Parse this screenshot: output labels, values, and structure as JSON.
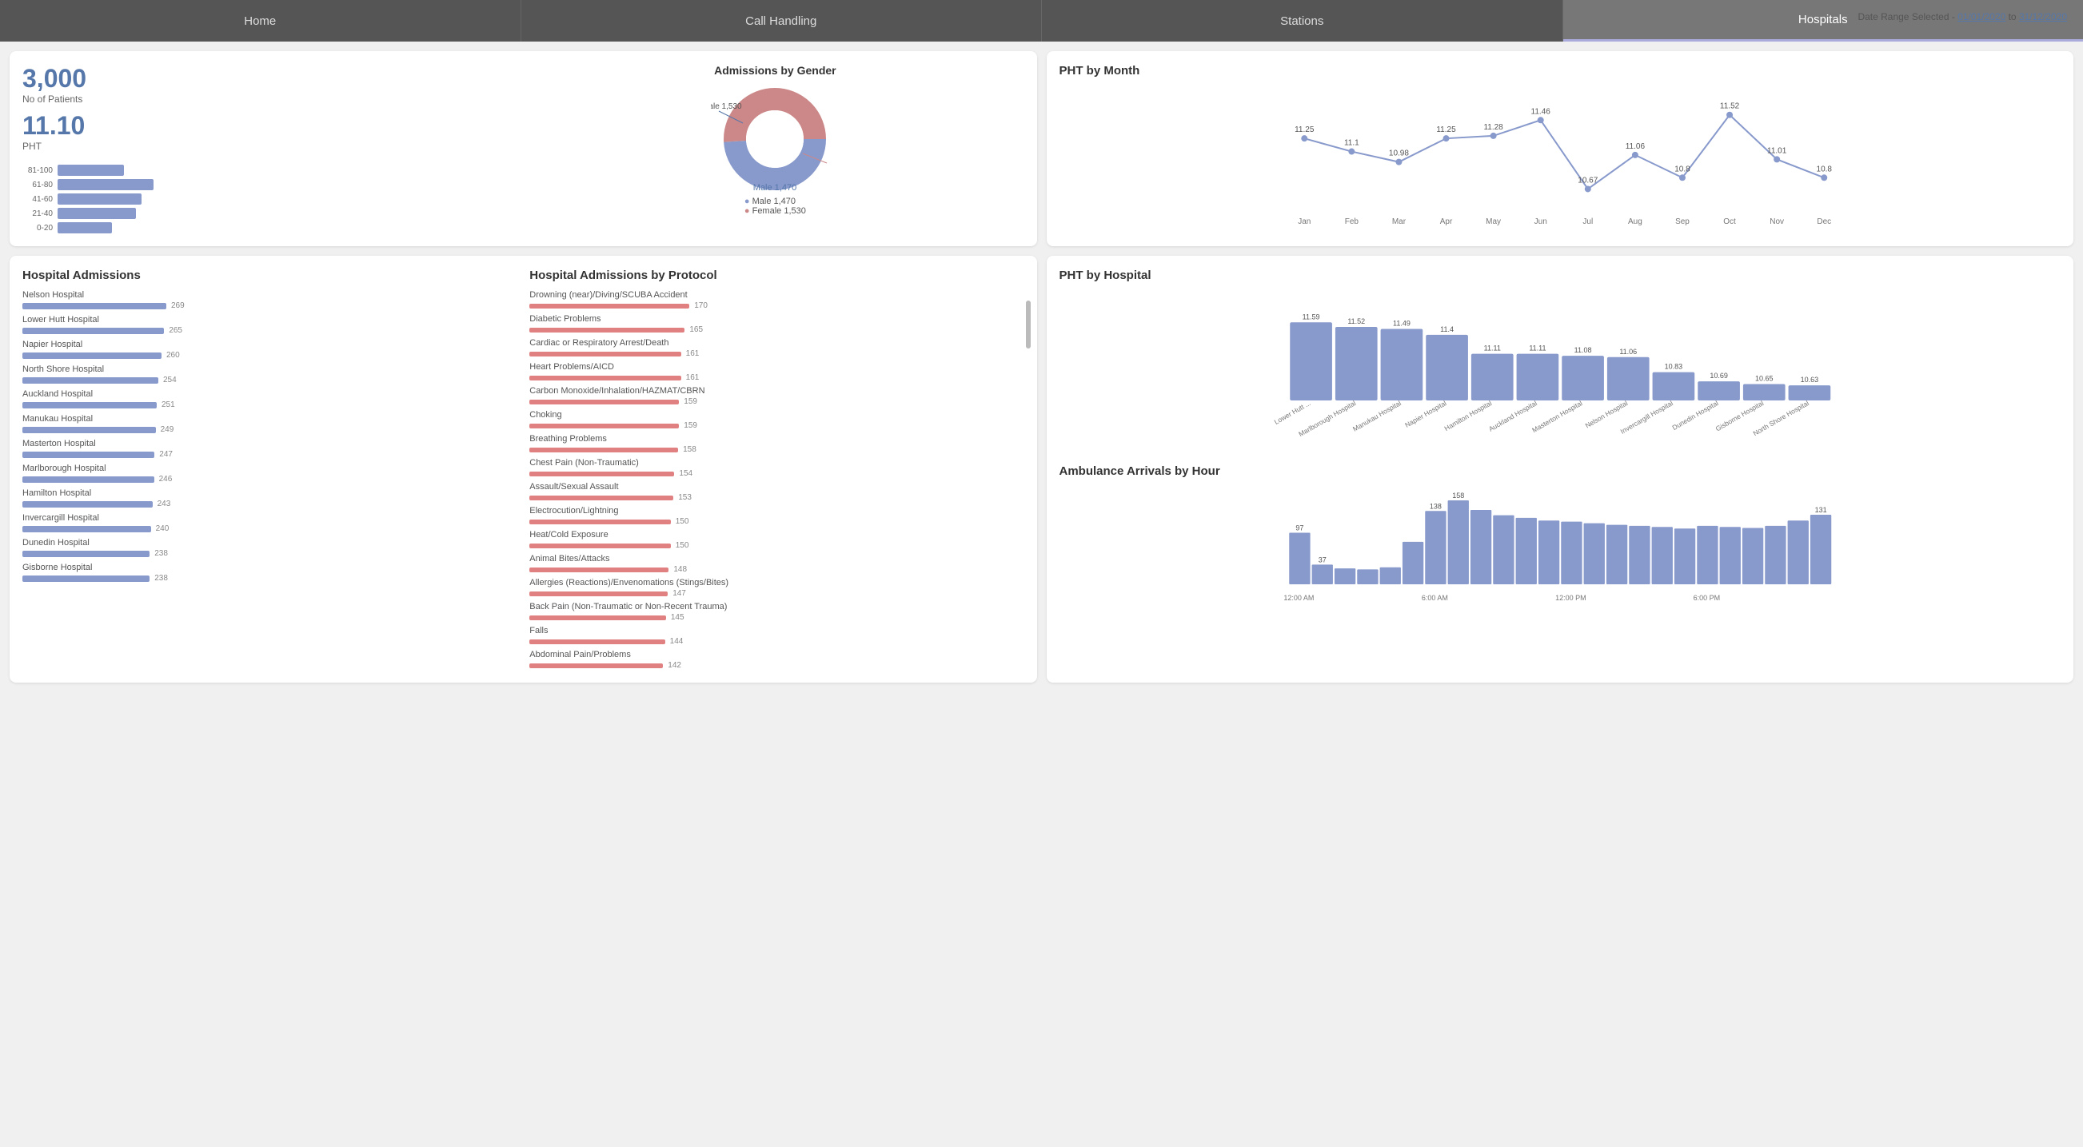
{
  "nav": {
    "items": [
      "Home",
      "Call Handling",
      "Stations",
      "Hospitals"
    ],
    "active": "Hospitals"
  },
  "dateRange": {
    "label": "Date Range Selected -",
    "from": "01/01/2020",
    "to": "31/12/2020"
  },
  "summary": {
    "patients": "3,000",
    "patients_label": "No of Patients",
    "pht": "11.10",
    "pht_label": "PHT",
    "age_bars": [
      {
        "range": "81-100",
        "width": 55
      },
      {
        "range": "61-80",
        "width": 80
      },
      {
        "range": "41-60",
        "width": 70
      },
      {
        "range": "21-40",
        "width": 65
      },
      {
        "range": "0-20",
        "width": 45
      }
    ],
    "gender_title": "Admissions by Gender",
    "male": "Male 1,470",
    "female": "Female 1,530"
  },
  "pht_month": {
    "title": "PHT by Month",
    "months": [
      "Jan",
      "Feb",
      "Mar",
      "Apr",
      "May",
      "Jun",
      "Jul",
      "Aug",
      "Sep",
      "Oct",
      "Nov",
      "Dec"
    ],
    "values": [
      11.25,
      11.1,
      10.98,
      11.25,
      11.28,
      11.46,
      10.67,
      11.06,
      10.8,
      11.52,
      11.01,
      10.8
    ]
  },
  "hospital_admissions": {
    "title": "Hospital Admissions",
    "hospitals": [
      {
        "name": "Nelson Hospital",
        "value": 269,
        "pct": 100
      },
      {
        "name": "Lower Hutt Hospital",
        "value": 265,
        "pct": 98
      },
      {
        "name": "Napier Hospital",
        "value": 260,
        "pct": 97
      },
      {
        "name": "North Shore Hospital",
        "value": 254,
        "pct": 94
      },
      {
        "name": "Auckland Hospital",
        "value": 251,
        "pct": 93
      },
      {
        "name": "Manukau Hospital",
        "value": 249,
        "pct": 93
      },
      {
        "name": "Masterton Hospital",
        "value": 247,
        "pct": 92
      },
      {
        "name": "Marlborough Hospital",
        "value": 246,
        "pct": 91
      },
      {
        "name": "Hamilton Hospital",
        "value": 243,
        "pct": 90
      },
      {
        "name": "Invercargill Hospital",
        "value": 240,
        "pct": 89
      },
      {
        "name": "Dunedin Hospital",
        "value": 238,
        "pct": 88
      },
      {
        "name": "Gisborne Hospital",
        "value": 238,
        "pct": 88
      }
    ]
  },
  "protocol_admissions": {
    "title": "Hospital Admissions by Protocol",
    "protocols": [
      {
        "name": "Drowning (near)/Diving/SCUBA Accident",
        "value": 170,
        "pct": 100
      },
      {
        "name": "Diabetic Problems",
        "value": 165,
        "pct": 97
      },
      {
        "name": "Cardiac or Respiratory Arrest/Death",
        "value": 161,
        "pct": 95
      },
      {
        "name": "Heart Problems/AICD",
        "value": 161,
        "pct": 95
      },
      {
        "name": "Carbon Monoxide/Inhalation/HAZMAT/CBRN",
        "value": 159,
        "pct": 94
      },
      {
        "name": "Choking",
        "value": 159,
        "pct": 94
      },
      {
        "name": "Breathing Problems",
        "value": 158,
        "pct": 93
      },
      {
        "name": "Chest Pain (Non-Traumatic)",
        "value": 154,
        "pct": 91
      },
      {
        "name": "Assault/Sexual Assault",
        "value": 153,
        "pct": 90
      },
      {
        "name": "Electrocution/Lightning",
        "value": 150,
        "pct": 88
      },
      {
        "name": "Heat/Cold Exposure",
        "value": 150,
        "pct": 88
      },
      {
        "name": "Animal Bites/Attacks",
        "value": 148,
        "pct": 87
      },
      {
        "name": "Allergies (Reactions)/Envenomations (Stings/Bites)",
        "value": 147,
        "pct": 86
      },
      {
        "name": "Back Pain (Non-Traumatic or Non-Recent Trauma)",
        "value": 145,
        "pct": 85
      },
      {
        "name": "Falls",
        "value": 144,
        "pct": 85
      },
      {
        "name": "Abdominal Pain/Problems",
        "value": 142,
        "pct": 84
      }
    ]
  },
  "pht_hospital": {
    "title": "PHT by Hospital",
    "hospitals": [
      {
        "name": "Lower Hutt ...",
        "value": 11.59
      },
      {
        "name": "Marlborough Hospital",
        "value": 11.52
      },
      {
        "name": "Manukau Hospital",
        "value": 11.49
      },
      {
        "name": "Napier Hospital",
        "value": 11.4
      },
      {
        "name": "Hamilton Hospital",
        "value": 11.11
      },
      {
        "name": "Auckland Hospital",
        "value": 11.11
      },
      {
        "name": "Masterton Hospital",
        "value": 11.08
      },
      {
        "name": "Nelson Hospital",
        "value": 11.06
      },
      {
        "name": "Invercargill Hospital",
        "value": 10.83
      },
      {
        "name": "Dunedin Hospital",
        "value": 10.69
      },
      {
        "name": "Gisborne Hospital",
        "value": 10.65
      },
      {
        "name": "North Shore Hospital",
        "value": 10.63
      }
    ]
  },
  "ambulance_arrivals": {
    "title": "Ambulance Arrivals by Hour",
    "labels": [
      "12:00 AM",
      "",
      "",
      "",
      "",
      "",
      "6:00 AM",
      "",
      "",
      "",
      "",
      "",
      "12:00 PM",
      "",
      "",
      "",
      "",
      "",
      "6:00 PM",
      "",
      "",
      "",
      "",
      ""
    ],
    "values": [
      97,
      37,
      30,
      28,
      32,
      80,
      138,
      158,
      140,
      130,
      125,
      120,
      118,
      115,
      112,
      110,
      108,
      105,
      110,
      108,
      106,
      110,
      120,
      131
    ],
    "x_labels": [
      "12:00 AM",
      "6:00 AM",
      "12:00 PM",
      "6:00 PM"
    ]
  }
}
